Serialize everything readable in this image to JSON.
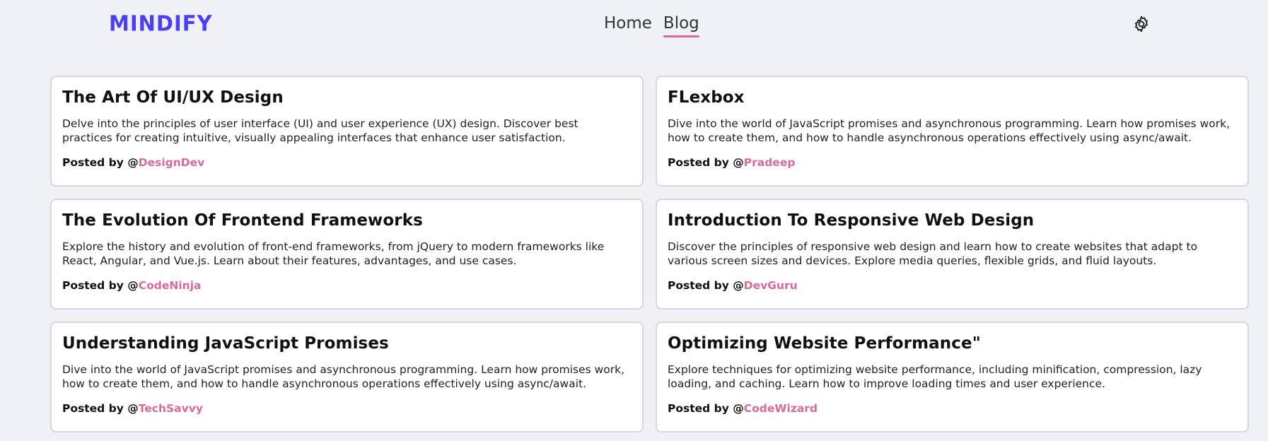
{
  "brand": {
    "logo": "MINDIFY",
    "accent": "#4b3ff1"
  },
  "nav": {
    "items": [
      {
        "label": "Home"
      },
      {
        "label": "Blog",
        "active": true
      }
    ],
    "underline_color": "#d96a9b"
  },
  "settings": {
    "icon": "gear-icon"
  },
  "posts": [
    {
      "title": "The Art Of UI/UX Design",
      "body": "Delve into the principles of user interface (UI) and user experience (UX) design. Discover best practices for creating intuitive, visually appealing interfaces that enhance user satisfaction.",
      "posted_by": "Posted by @",
      "author": "DesignDev"
    },
    {
      "title": "FLexbox",
      "body": "Dive into the world of JavaScript promises and asynchronous programming. Learn how promises work, how to create them, and how to handle asynchronous operations effectively using async/await.",
      "posted_by": "Posted by @",
      "author": "Pradeep"
    },
    {
      "title": "The Evolution Of Frontend Frameworks",
      "body": "Explore the history and evolution of front-end frameworks, from jQuery to modern frameworks like React, Angular, and Vue.js. Learn about their features, advantages, and use cases.",
      "posted_by": "Posted by @",
      "author": "CodeNinja"
    },
    {
      "title": "Introduction To Responsive Web Design",
      "body": "Discover the principles of responsive web design and learn how to create websites that adapt to various screen sizes and devices. Explore media queries, flexible grids, and fluid layouts.",
      "posted_by": "Posted by @",
      "author": "DevGuru"
    },
    {
      "title": "Understanding JavaScript Promises",
      "body": "Dive into the world of JavaScript promises and asynchronous programming. Learn how promises work, how to create them, and how to handle asynchronous operations effectively using async/await.",
      "posted_by": "Posted by @",
      "author": "TechSavvy"
    },
    {
      "title": "Optimizing Website Performance\"",
      "body": "Explore techniques for optimizing website performance, including minification, compression, lazy loading, and caching. Learn how to improve loading times and user experience.",
      "posted_by": "Posted by @",
      "author": "CodeWizard"
    }
  ]
}
